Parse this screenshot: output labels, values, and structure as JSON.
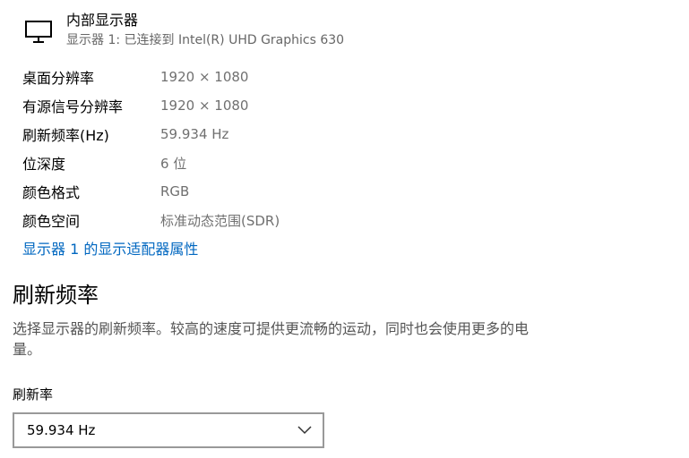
{
  "display": {
    "name": "内部显示器",
    "subtitle": "显示器 1: 已连接到 Intel(R) UHD Graphics 630",
    "icon": "monitor-icon"
  },
  "properties": [
    {
      "label": "桌面分辨率",
      "value": "1920 × 1080"
    },
    {
      "label": "有源信号分辨率",
      "value": "1920 × 1080"
    },
    {
      "label": "刷新频率(Hz)",
      "value": "59.934 Hz"
    },
    {
      "label": "位深度",
      "value": "6 位"
    },
    {
      "label": "颜色格式",
      "value": "RGB"
    },
    {
      "label": "颜色空间",
      "value": "标准动态范围(SDR)"
    }
  ],
  "adapter_link": "显示器 1 的显示适配器属性",
  "refresh_section": {
    "title": "刷新频率",
    "description": "选择显示器的刷新频率。较高的速度可提供更流畅的运动，同时也会使用更多的电量。",
    "select_label": "刷新率",
    "selected_value": "59.934 Hz",
    "dropdown_icon": "chevron-down-icon"
  },
  "colors": {
    "link": "#0067c0",
    "secondary_text": "#707070",
    "select_border": "#999999"
  }
}
